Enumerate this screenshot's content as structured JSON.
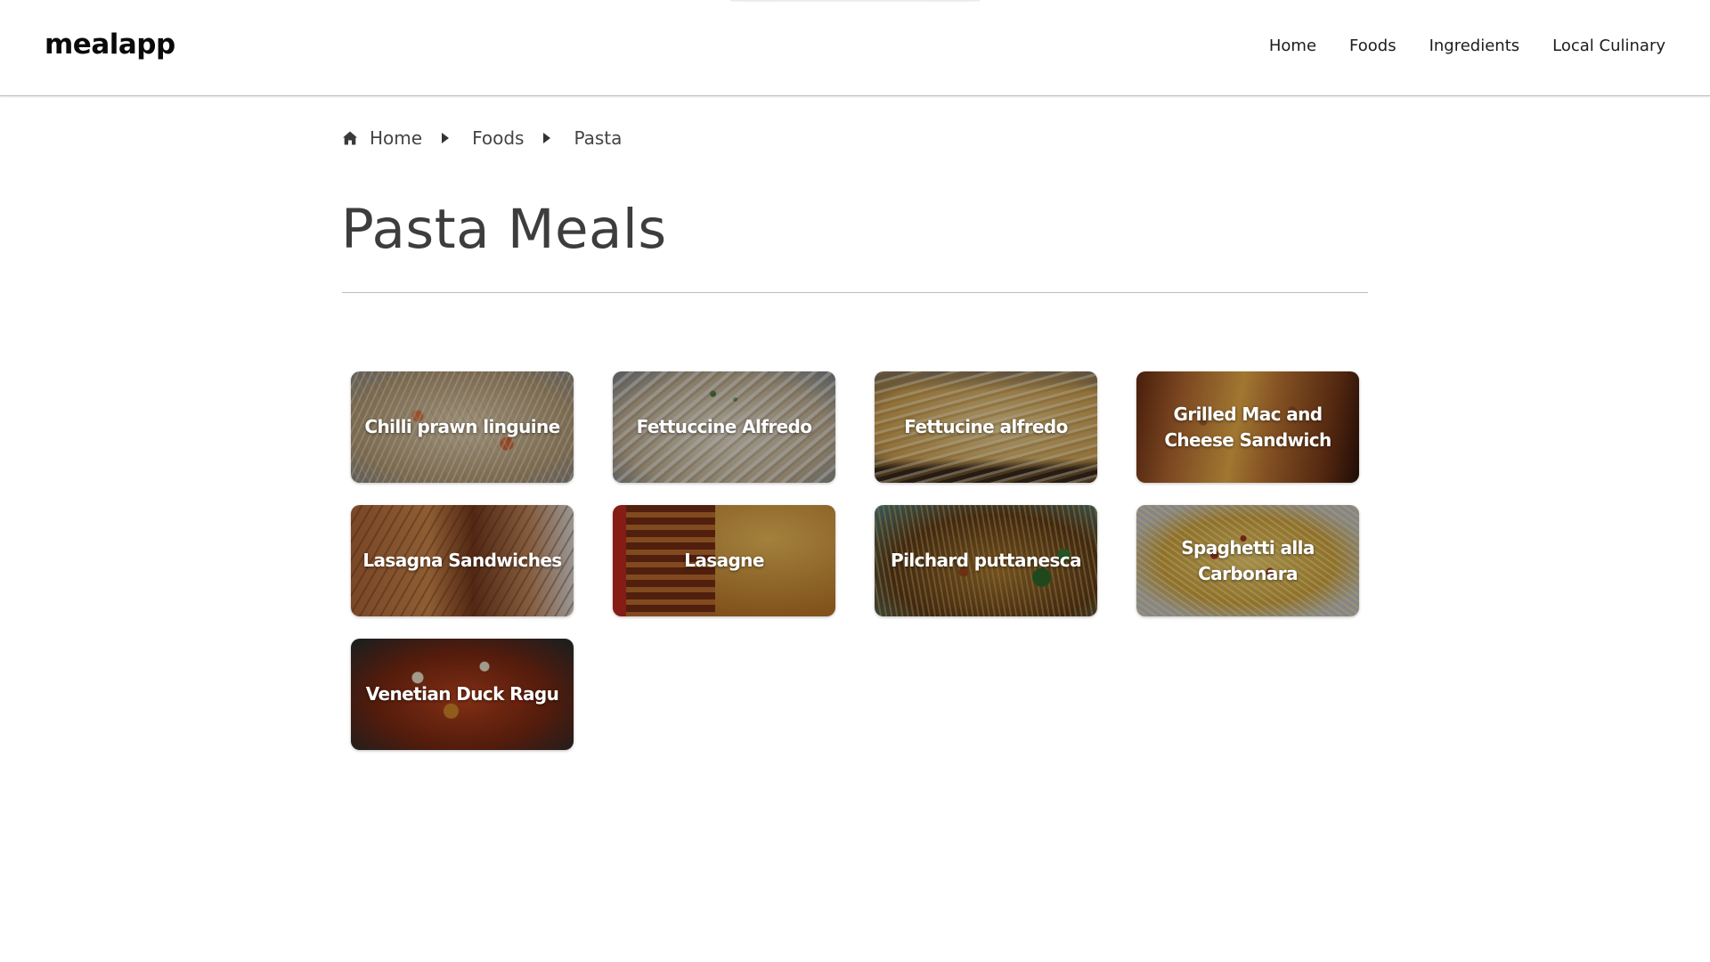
{
  "header": {
    "logo": "mealapp",
    "nav": [
      "Home",
      "Foods",
      "Ingredients",
      "Local Culinary"
    ]
  },
  "breadcrumb": {
    "items": [
      "Home",
      "Foods",
      "Pasta"
    ]
  },
  "page": {
    "title": "Pasta Meals"
  },
  "meals": [
    {
      "name": "Chilli prawn linguine",
      "icon": "linguine-photo"
    },
    {
      "name": "Fettuccine Alfredo",
      "icon": "fettuccine-photo"
    },
    {
      "name": "Fettucine alfredo",
      "icon": "fettucine-photo"
    },
    {
      "name": "Grilled Mac and Cheese Sandwich",
      "icon": "grilled-sandwich-photo"
    },
    {
      "name": "Lasagna Sandwiches",
      "icon": "lasagna-sandwich-photo"
    },
    {
      "name": "Lasagne",
      "icon": "lasagne-photo"
    },
    {
      "name": "Pilchard puttanesca",
      "icon": "puttanesca-photo"
    },
    {
      "name": "Spaghetti alla Carbonara",
      "icon": "carbonara-photo"
    },
    {
      "name": "Venetian Duck Ragu",
      "icon": "duck-ragu-photo"
    }
  ],
  "colors": {
    "text": "#222222",
    "title": "#3d3d3d",
    "divider": "#bdbdbd",
    "card_overlay": "rgba(0,0,0,0.33)"
  }
}
